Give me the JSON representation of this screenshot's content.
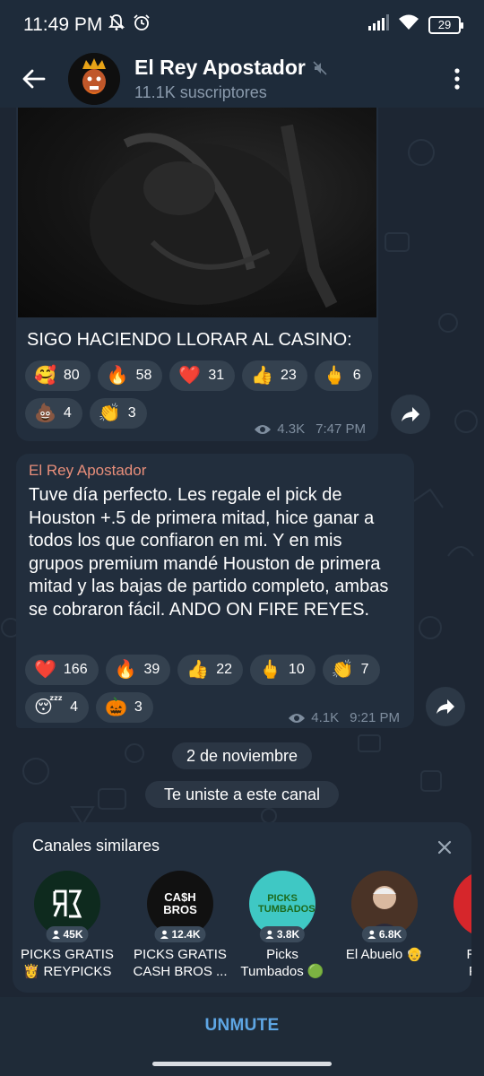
{
  "status_bar": {
    "time": "11:49 PM",
    "battery": "29",
    "icons": [
      "bell-off-icon",
      "alarm-icon",
      "signal-icon",
      "wifi-icon",
      "battery-icon"
    ]
  },
  "header": {
    "title": "El Rey Apostador",
    "subtitle": "11.1K suscriptores",
    "icons": [
      "back-arrow-icon",
      "muted-icon",
      "more-vert-icon"
    ]
  },
  "messages": [
    {
      "caption": "SIGO HACIENDO LLORAR AL CASINO:",
      "reactions": [
        {
          "emoji": "🥰",
          "count": "80"
        },
        {
          "emoji": "🔥",
          "count": "58"
        },
        {
          "emoji": "❤️",
          "count": "31"
        },
        {
          "emoji": "👍",
          "count": "23"
        },
        {
          "emoji": "🖕",
          "count": "6"
        },
        {
          "emoji": "💩",
          "count": "4"
        },
        {
          "emoji": "👏",
          "count": "3"
        }
      ],
      "views": "4.3K",
      "time": "7:47 PM"
    },
    {
      "sender": "El Rey Apostador",
      "text": "Tuve día perfecto. Les regale el pick de Houston +.5 de primera mitad, hice ganar a todos los que confiaron en mi. Y en mis grupos premium mandé Houston de primera mitad y las bajas de partido completo, ambas se cobraron fácil. ANDO ON FIRE REYES.",
      "reactions": [
        {
          "emoji": "❤️",
          "count": "166"
        },
        {
          "emoji": "🔥",
          "count": "39"
        },
        {
          "emoji": "👍",
          "count": "22"
        },
        {
          "emoji": "🖕",
          "count": "10"
        },
        {
          "emoji": "👏",
          "count": "7"
        },
        {
          "emoji": "😴",
          "count": "4"
        },
        {
          "emoji": "🎃",
          "count": "3"
        }
      ],
      "views": "4.1K",
      "time": "9:21 PM"
    }
  ],
  "date_pill": "2 de noviembre",
  "service_pill": "Te uniste a este canal",
  "similar": {
    "title": "Canales similares",
    "channels": [
      {
        "name_line1": "PICKS GRATIS",
        "name_line2": "👸 REYPICKS",
        "count": "45K",
        "avatar_color": "#0e2a1e"
      },
      {
        "name_line1": "PICKS GRATIS",
        "name_line2": "CASH BROS ...",
        "count": "12.4K",
        "avatar_color": "#111111"
      },
      {
        "name_line1": "Picks",
        "name_line2": "Tumbados 🟢",
        "count": "3.8K",
        "avatar_color": "#3fc8c4"
      },
      {
        "name_line1": "El Abuelo 👴",
        "name_line2": "",
        "count": "6.8K",
        "avatar_color": "#5a3a2a"
      },
      {
        "name_line1": "REYPI",
        "name_line2": "FREE",
        "count": "",
        "avatar_color": "#d6262b"
      }
    ],
    "avatar_text": {
      "cashbros": "CA$H BROS",
      "tumbados": "PICKS TUMBADOS"
    }
  },
  "bottom": {
    "label": "UNMUTE"
  }
}
